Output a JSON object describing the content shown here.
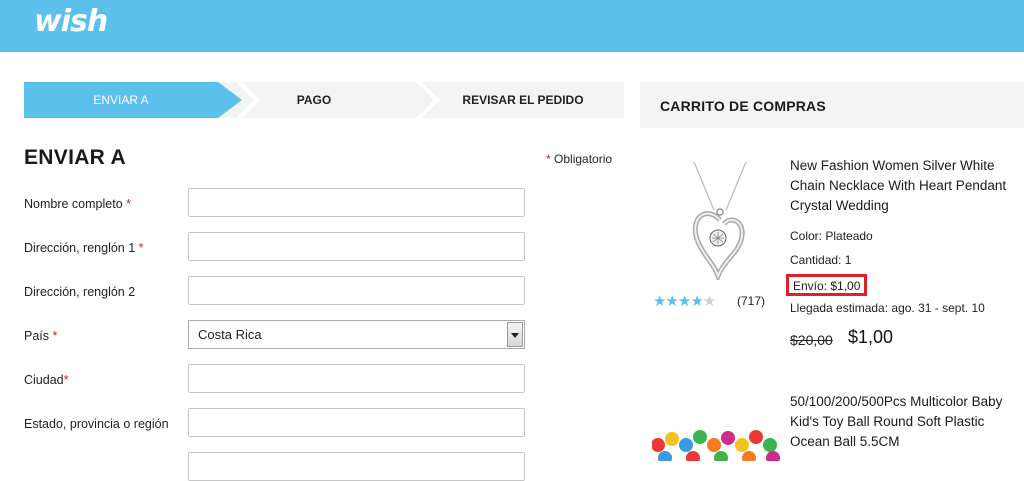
{
  "header": {
    "logo": "wish"
  },
  "steps": [
    {
      "label": "ENVIAR A"
    },
    {
      "label": "PAGO"
    },
    {
      "label": "REVISAR EL PEDIDO"
    }
  ],
  "form": {
    "title": "ENVIAR A",
    "required_note": "Obligatorio",
    "fields": [
      {
        "label": "Nombre completo",
        "required": true,
        "value": ""
      },
      {
        "label": "Dirección, renglón 1",
        "required": true,
        "value": ""
      },
      {
        "label": "Dirección, renglón 2",
        "required": false,
        "value": ""
      },
      {
        "label": "País",
        "required": true,
        "value": "Costa Rica"
      },
      {
        "label": "Ciudad",
        "required": true,
        "value": ""
      },
      {
        "label": "Estado, provincia o región",
        "required": false,
        "value": ""
      }
    ]
  },
  "cart": {
    "title": "CARRITO DE COMPRAS",
    "items": [
      {
        "name": "New Fashion Women Silver White Chain Necklace With Heart Pendant Crystal Wedding",
        "color": "Color: Plateado",
        "quantity": "Cantidad:  1",
        "shipping": "Envío: $1,00",
        "arrival": "Llegada estimada: ago. 31 - sept. 10",
        "old_price": "$20,00",
        "price": "$1,00",
        "rating_count": "(717)",
        "rating_stars": 4
      },
      {
        "name": "50/100/200/500Pcs Multicolor Baby Kid's Toy Ball Round Soft Plastic Ocean Ball 5.5CM"
      }
    ]
  },
  "colors": {
    "brand": "#5bc1ec",
    "required": "#d02020",
    "highlight": "#e0202a"
  }
}
